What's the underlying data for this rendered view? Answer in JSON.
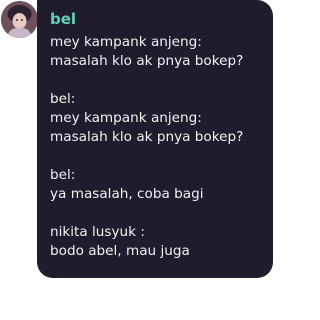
{
  "avatar": {
    "icon": "profile-picture"
  },
  "message": {
    "sender": "bel",
    "lines": [
      "mey kampank anjeng:",
      "masalah klo ak pnya bokep?",
      "",
      "bel:",
      "mey kampank anjeng:",
      "masalah klo ak pnya bokep?",
      "",
      "bel:",
      "ya masalah, coba bagi",
      "",
      "nikita lusyuk :",
      "bodo abel, mau juga"
    ]
  },
  "colors": {
    "bubble": "#201c2b",
    "sender_name": "#5fd3b6",
    "text": "#f1f1f4"
  }
}
